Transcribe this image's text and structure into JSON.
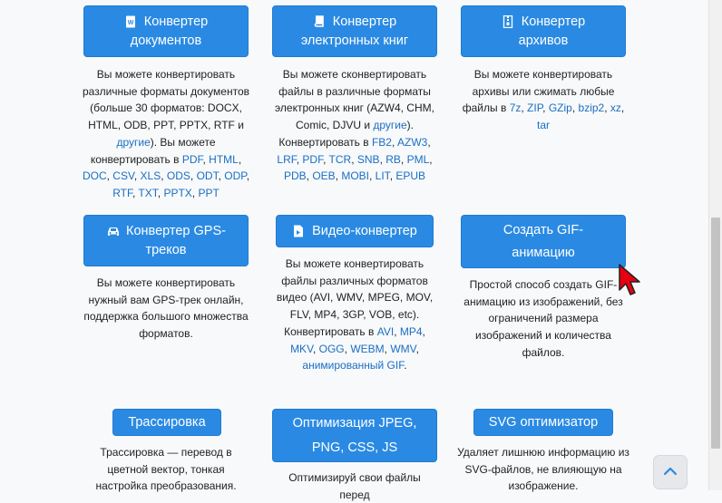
{
  "cards": {
    "documents": {
      "label_line1": "Конвертер",
      "label_line2": "документов",
      "desc_intro": "Вы можете конвертировать различные форматы документов (больше 30 форматов: DOCX, HTML, ODB, PPT, PPTX, RTF и",
      "other_link": "другие",
      "desc_mid": "). Вы можете конвертировать в",
      "links": [
        "PDF",
        "HTML",
        "DOC",
        "CSV",
        "XLS",
        "ODS",
        "ODT",
        "ODP",
        "RTF",
        "TXT",
        "PPTX",
        "PPT"
      ]
    },
    "ebooks": {
      "label_line1": "Конвертер",
      "label_line2": "электронных книг",
      "desc_intro": "Вы можете сконвертировать файлы в различные форматы электронных книг (AZW4, CHM, Comic, DJVU и",
      "other_link": "другие",
      "desc_mid": "). Конвертировать в",
      "links": [
        "FB2",
        "AZW3",
        "LRF",
        "PDF",
        "TCR",
        "SNB",
        "RB",
        "PML",
        "PDB",
        "OEB",
        "MOBI",
        "LIT",
        "EPUB"
      ]
    },
    "archives": {
      "label_line1": "Конвертер",
      "label_line2": "архивов",
      "desc_intro": "Вы можете конвертировать архивы или сжимать любые файлы в",
      "links": [
        "7z",
        "ZIP",
        "GZip",
        "bzip2",
        "xz",
        "tar"
      ]
    },
    "gps": {
      "label_line1": "Конвертер GPS-",
      "label_line2": "треков",
      "desc": "Вы можете конвертировать нужный вам GPS-трек онлайн, поддержка большого множества форматов."
    },
    "video": {
      "label": "Видео-конвертер",
      "desc_intro": "Вы можете конвертировать файлы различных форматов видео (AVI, WMV, MPEG, MOV, FLV, MP4, 3GP, VOB, etc). Конвертировать в",
      "links": [
        "AVI",
        "MP4",
        "MKV",
        "OGG",
        "WEBM",
        "WMV",
        "анимированный GIF"
      ]
    },
    "gif": {
      "label_line1": "Создать GIF-",
      "label_line2": "анимацию",
      "desc": "Простой способ создать GIF-анимацию из изображений, без ограничений размера изображений и количества файлов."
    },
    "trace": {
      "label": "Трассировка",
      "desc": "Трассировка — перевод в цветной вектор, тонкая настройка преобразования."
    },
    "jpeg": {
      "label_line1": "Оптимизация JPEG,",
      "label_line2": "PNG, CSS, JS",
      "desc": "Оптимизируй свои файлы перед"
    },
    "svg": {
      "label": "SVG оптимизатор",
      "desc": "Удаляет лишнюю информацию из SVG-файлов, не влияющую на изображение."
    }
  },
  "colors": {
    "button": "#2a8ae3",
    "link": "#1a6fc4",
    "background": "#f8f9fa"
  },
  "icons": [
    "word-document-icon",
    "book-icon",
    "archive-icon",
    "car-icon",
    "video-file-icon",
    "chevron-up-icon",
    "mouse-cursor-icon"
  ]
}
